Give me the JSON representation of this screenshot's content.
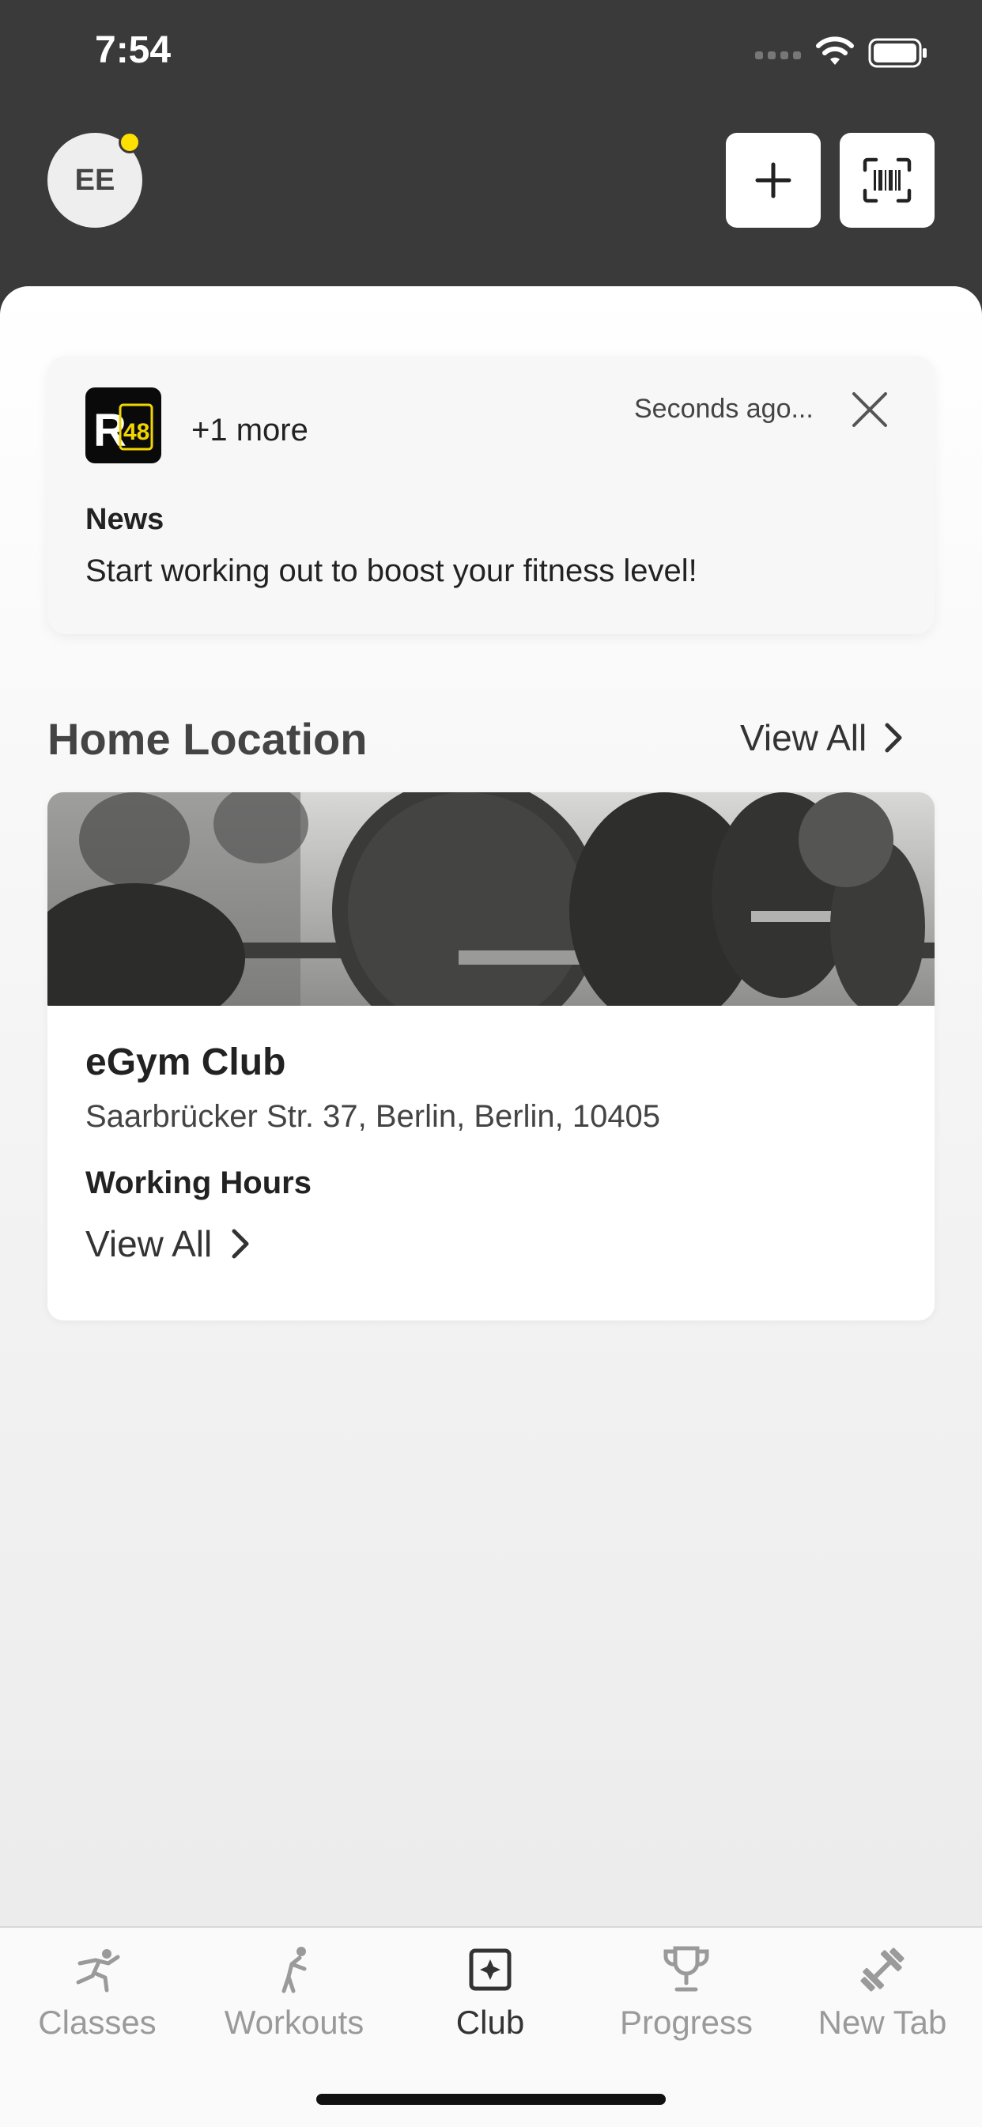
{
  "status_bar": {
    "time": "7:54"
  },
  "header": {
    "avatar_initials": "EE"
  },
  "news_card": {
    "more_label": "+1 more",
    "timestamp": "Seconds ago...",
    "title": "News",
    "body": "Start working out to boost your fitness level!",
    "logo_text": "R48"
  },
  "home_location": {
    "section_title": "Home Location",
    "view_all_label": "View All",
    "club_name": "eGym Club",
    "club_address": "Saarbrücker Str. 37, Berlin, Berlin, 10405",
    "hours_label": "Working Hours",
    "hours_link_label": "View All"
  },
  "tabs": [
    {
      "label": "Classes",
      "icon": "running-person-icon",
      "active": false
    },
    {
      "label": "Workouts",
      "icon": "stretching-person-icon",
      "active": false
    },
    {
      "label": "Club",
      "icon": "club-icon",
      "active": true
    },
    {
      "label": "Progress",
      "icon": "trophy-icon",
      "active": false
    },
    {
      "label": "New Tab",
      "icon": "dumbbell-icon",
      "active": false
    }
  ],
  "colors": {
    "header_bg": "#3a3a3a",
    "notification_dot": "#ffe000",
    "active_tab": "#333333",
    "inactive_tab": "#9a9a9a"
  }
}
